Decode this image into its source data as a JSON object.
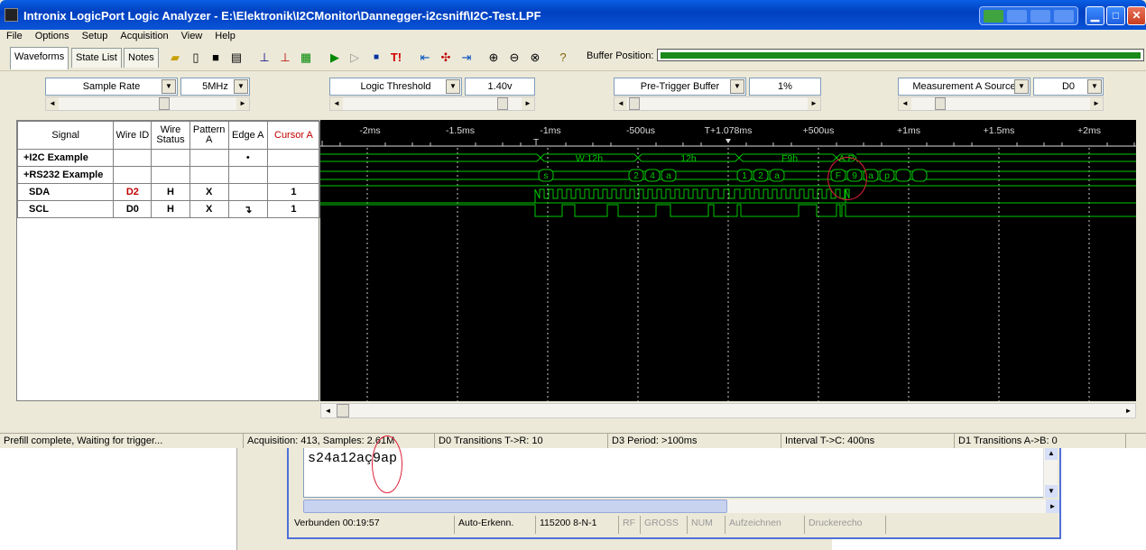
{
  "app": {
    "title": "Intronix LogicPort Logic Analyzer - E:\\Elektronik\\I2CMonitor\\Dannegger-i2csniff\\I2C-Test.LPF"
  },
  "menu": [
    "File",
    "Options",
    "Setup",
    "Acquisition",
    "View",
    "Help"
  ],
  "toolbar": {
    "tabs": [
      "Waveforms",
      "State List",
      "Notes"
    ],
    "buffer_label": "Buffer Position:"
  },
  "controls": {
    "sample_rate": {
      "label": "Sample Rate",
      "value": "5MHz"
    },
    "logic_threshold": {
      "label": "Logic Threshold",
      "value": "1.40v"
    },
    "pretrigger": {
      "label": "Pre-Trigger Buffer",
      "value": "1%"
    },
    "measurement": {
      "label": "Measurement A Source",
      "value": "D0"
    }
  },
  "table": {
    "headers": [
      "Signal",
      "Wire ID",
      "Wire Status",
      "Pattern A",
      "Edge A",
      "Cursor A"
    ],
    "rows": [
      {
        "signal": "+I2C Example",
        "wire_id": "",
        "status": "",
        "pattern": "",
        "edge": "•",
        "cursor": ""
      },
      {
        "signal": "+RS232 Example",
        "wire_id": "",
        "status": "",
        "pattern": "",
        "edge": "",
        "cursor": ""
      },
      {
        "signal": "SDA",
        "wire_id": "D2",
        "status": "H",
        "pattern": "X",
        "edge": "",
        "cursor": "1"
      },
      {
        "signal": "SCL",
        "wire_id": "D0",
        "status": "H",
        "pattern": "X",
        "edge": "↴",
        "cursor": "1"
      }
    ]
  },
  "waveform": {
    "time_labels": [
      "-2ms",
      "-1.5ms",
      "-1ms",
      "-500us",
      "T+1.078ms",
      "+500us",
      "+1ms",
      "+1.5ms",
      "+2ms"
    ],
    "i2c_labels": [
      "W:12h",
      "12h",
      "F9h",
      "A:P"
    ],
    "rs232_labels": [
      "s",
      "2",
      "4",
      "a",
      "1",
      "2",
      "a",
      "F",
      "9",
      "a",
      "p"
    ]
  },
  "status": {
    "cells": [
      "Prefill complete, Waiting for trigger...",
      "Acquisition: 413, Samples: 2.61M",
      "D0 Transitions T->R: 10",
      "D3 Period: >100ms",
      "Interval T->C: 400ns",
      "D1 Transitions A->B: 0"
    ]
  },
  "terminal": {
    "text": "s24a12aç9ap",
    "status": [
      "Verbunden 00:19:57",
      "Auto-Erkenn.",
      "115200 8-N-1",
      "RF",
      "GROSS",
      "NUM",
      "Aufzeichnen",
      "Druckerecho"
    ]
  },
  "colors": {
    "wave": "#00c800",
    "bg": "#000000",
    "highlight": "#e0203a",
    "wire_id": "#c00000"
  }
}
